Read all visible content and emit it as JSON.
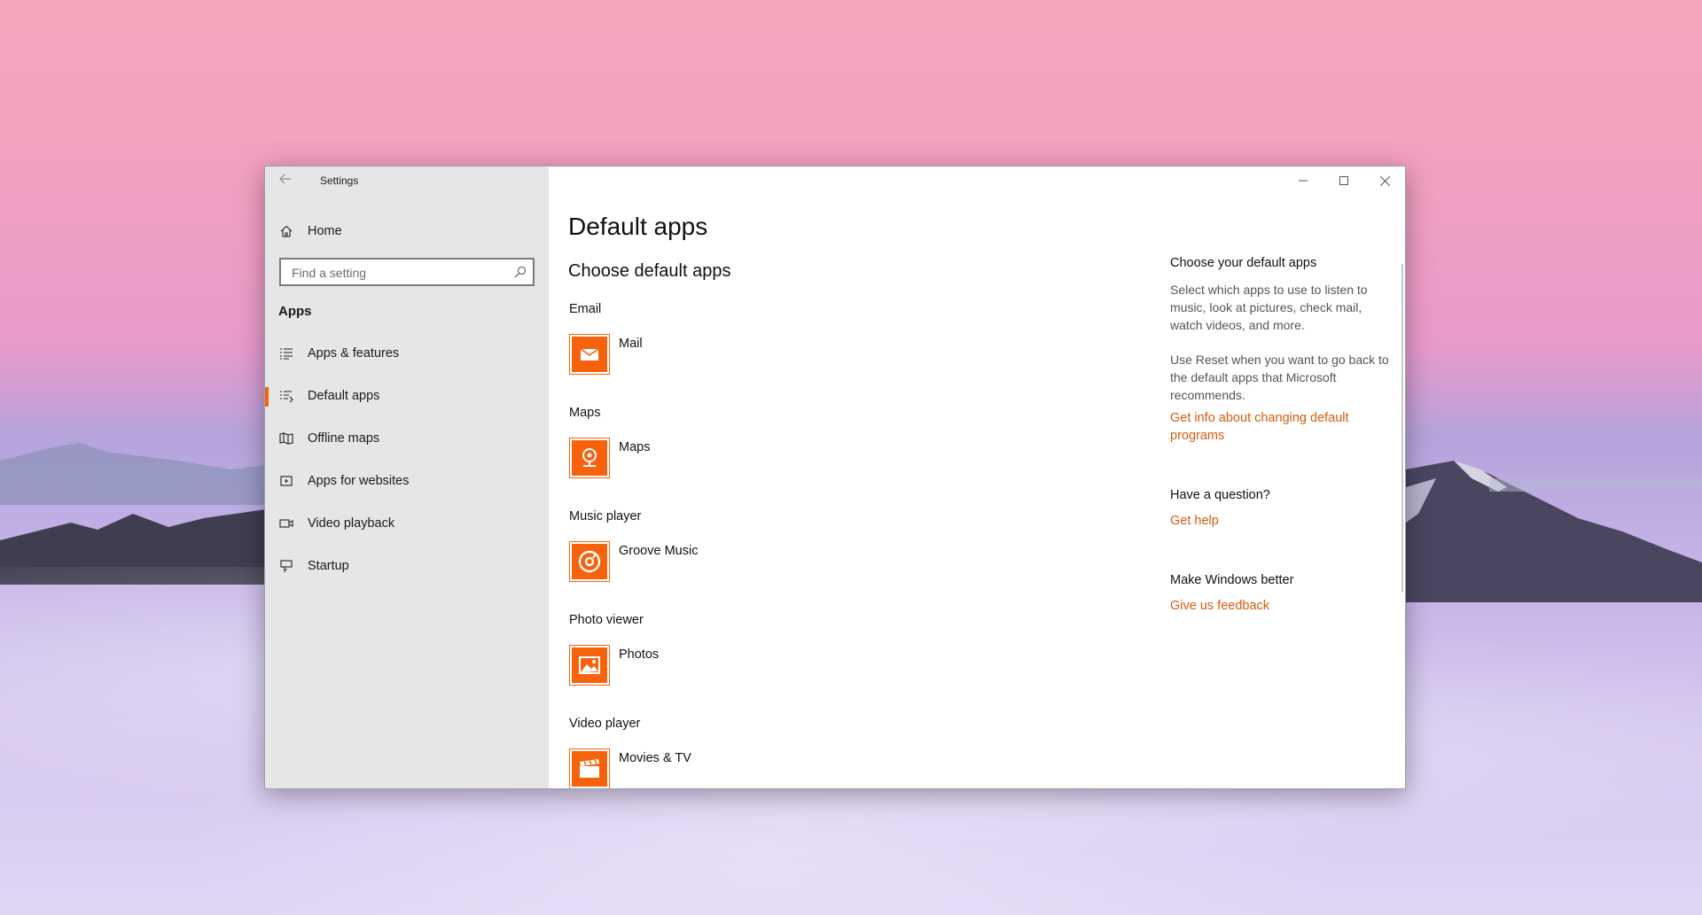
{
  "window": {
    "title": "Settings"
  },
  "sidebar": {
    "home_label": "Home",
    "search_placeholder": "Find a setting",
    "section": "Apps",
    "items": [
      {
        "label": "Apps & features",
        "icon": "list-icon",
        "active": false
      },
      {
        "label": "Default apps",
        "icon": "default-apps-icon",
        "active": true
      },
      {
        "label": "Offline maps",
        "icon": "map-icon",
        "active": false
      },
      {
        "label": "Apps for websites",
        "icon": "apps-websites-icon",
        "active": false
      },
      {
        "label": "Video playback",
        "icon": "video-icon",
        "active": false
      },
      {
        "label": "Startup",
        "icon": "startup-icon",
        "active": false
      }
    ]
  },
  "main": {
    "title": "Default apps",
    "subtitle": "Choose default apps",
    "categories": [
      {
        "label": "Email",
        "app": "Mail",
        "icon": "mail-icon"
      },
      {
        "label": "Maps",
        "app": "Maps",
        "icon": "maps-icon"
      },
      {
        "label": "Music player",
        "app": "Groove Music",
        "icon": "groove-icon"
      },
      {
        "label": "Photo viewer",
        "app": "Photos",
        "icon": "photos-icon"
      },
      {
        "label": "Video player",
        "app": "Movies & TV",
        "icon": "movies-icon"
      }
    ]
  },
  "aside": {
    "heading1": "Choose your default apps",
    "para1": "Select which apps to use to listen to music, look at pictures, check mail, watch videos, and more.",
    "para2": "Use Reset when you want to go back to the default apps that Microsoft recommends.",
    "link1": "Get info about changing default programs",
    "heading2": "Have a question?",
    "link2": "Get help",
    "heading3": "Make Windows better",
    "link3": "Give us feedback"
  },
  "colors": {
    "accent": "#f7630c",
    "link": "#d85a0c",
    "sidebar_bg": "#e6e6e6"
  }
}
